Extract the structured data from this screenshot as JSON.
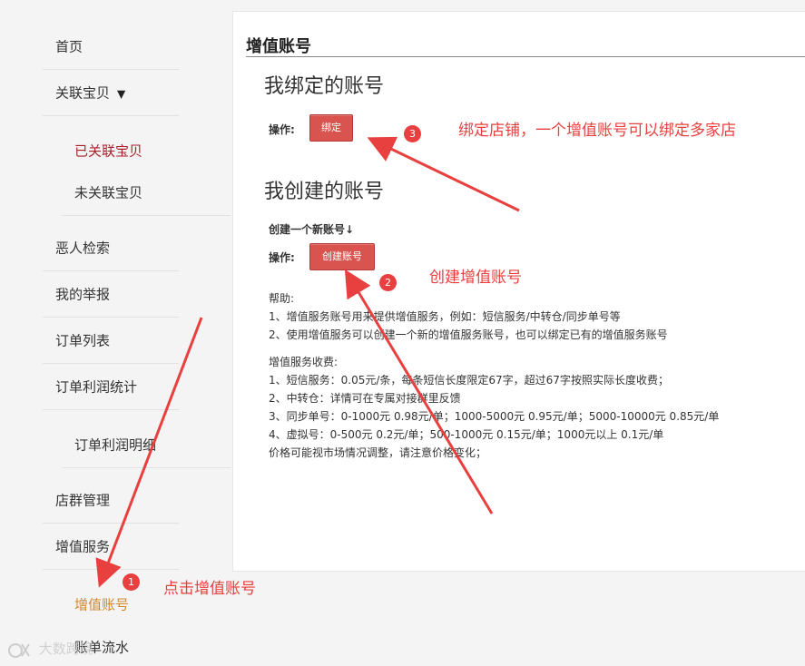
{
  "sidebar": {
    "items": [
      {
        "label": "首页"
      },
      {
        "label": "关联宝贝"
      },
      {
        "label": "已关联宝贝"
      },
      {
        "label": "未关联宝贝"
      },
      {
        "label": "恶人检索"
      },
      {
        "label": "我的举报"
      },
      {
        "label": "订单列表"
      },
      {
        "label": "订单利润统计"
      },
      {
        "label": "订单利润明细"
      },
      {
        "label": "店群管理"
      },
      {
        "label": "增值服务"
      },
      {
        "label": "增值账号"
      },
      {
        "label": "账单流水"
      }
    ],
    "caret_glyph": "▼",
    "colors": {
      "active_sub": "#a8202a",
      "current": "#d2872a"
    }
  },
  "main": {
    "title": "增值账号",
    "bound": {
      "title": "我绑定的账号",
      "op_label": "操作:",
      "button": "绑定"
    },
    "created": {
      "title": "我创建的账号",
      "create_new": "创建一个新账号↓",
      "op_label": "操作:",
      "button": "创建账号"
    },
    "help": {
      "heading": "帮助:",
      "lines": [
        "1、增值服务账号用来提供增值服务，例如：短信服务/中转仓/同步单号等",
        "2、使用增值服务可以创建一个新的增值服务账号，也可以绑定已有的增值服务账号"
      ]
    },
    "fees": {
      "heading": "增值服务收费:",
      "lines": [
        "1、短信服务：0.05元/条，每条短信长度限定67字，超过67字按照实际长度收费；",
        "2、中转仓：详情可在专属对接群里反馈",
        "3、同步单号：0-1000元 0.98元/单；1000-5000元 0.95元/单；5000-10000元 0.85元/单",
        "4、虚拟号：0-500元 0.2元/单；500-1000元 0.15元/单；1000元以上 0.1元/单",
        "价格可能视市场情况调整，请注意价格变化；"
      ]
    },
    "button_color": "#d9534f"
  },
  "annotations": {
    "color": "#e8403f",
    "items": [
      {
        "number": "1",
        "text": "点击增值账号"
      },
      {
        "number": "2",
        "text": "创建增值账号"
      },
      {
        "number": "3",
        "text": "绑定店铺，一个增值账号可以绑定多家店"
      }
    ]
  },
  "watermark": {
    "text": "大数跨境"
  }
}
